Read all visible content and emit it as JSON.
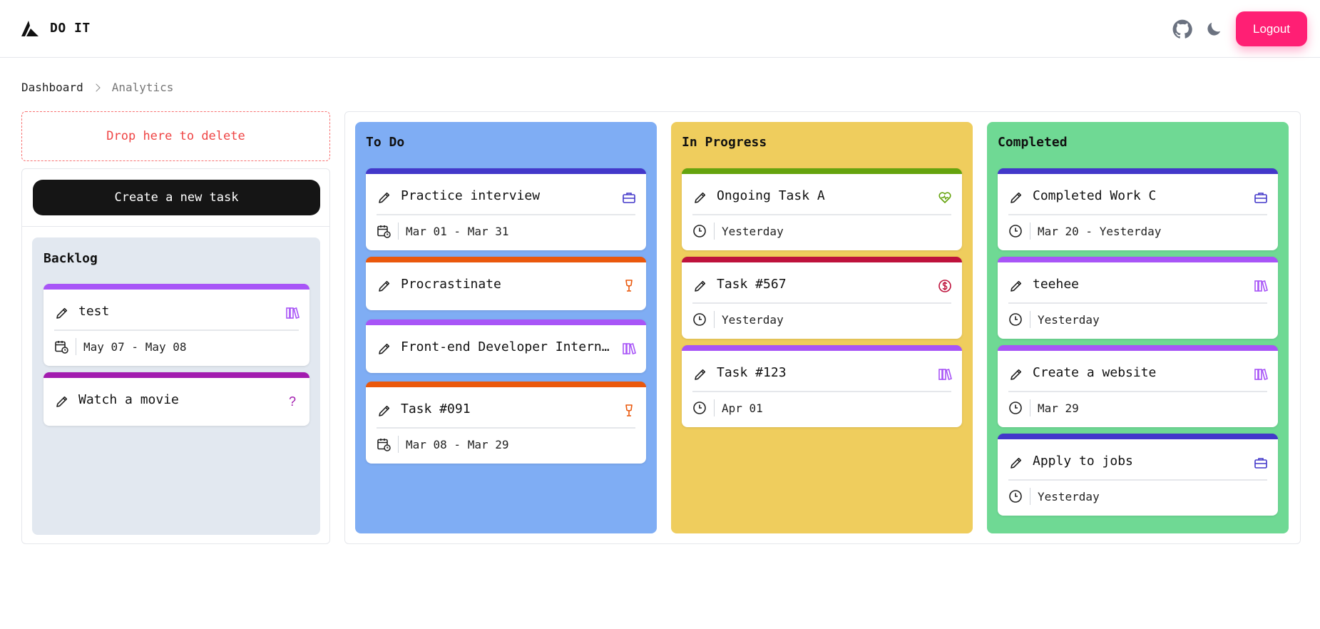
{
  "app": {
    "brand": "DO IT",
    "logout_label": "Logout"
  },
  "breadcrumb": {
    "home": "Dashboard",
    "current": "Analytics"
  },
  "drop_zone": {
    "label": "Drop here to delete"
  },
  "create_button": {
    "label": "Create a new task"
  },
  "colors": {
    "logout": "#ff1f74",
    "todo": "#7fadf4",
    "in_progress": "#efcd5d",
    "completed": "#6fd994",
    "backlog": "#e2e8f0",
    "stripe_indigo": "#4338ca",
    "stripe_orange": "#ea580c",
    "stripe_purple": "#a855f7",
    "stripe_magenta": "#a21caf",
    "stripe_green": "#65a30d",
    "stripe_red": "#be123c"
  },
  "backlog": {
    "title": "Backlog",
    "cards": [
      {
        "title": "test",
        "category_icon": "books-icon",
        "date_icon": "calendar-clock-icon",
        "date": "May 07 - May 08"
      },
      {
        "title": "Watch a movie",
        "category_icon": "question-icon",
        "category_glyph": "?"
      }
    ]
  },
  "columns": {
    "todo": {
      "title": "To Do",
      "cards": [
        {
          "title": "Practice interview",
          "category_icon": "briefcase-icon",
          "date_icon": "calendar-clock-icon",
          "date": "Mar 01 - Mar 31"
        },
        {
          "title": "Procrastinate",
          "category_icon": "drink-icon"
        },
        {
          "title": "Front-end Developer Internaa…",
          "category_icon": "books-icon"
        },
        {
          "title": "Task #091",
          "category_icon": "drink-icon",
          "date_icon": "calendar-clock-icon",
          "date": "Mar 08 - Mar 29"
        }
      ]
    },
    "in_progress": {
      "title": "In Progress",
      "cards": [
        {
          "title": "Ongoing Task A",
          "category_icon": "heart-pulse-icon",
          "date_icon": "clock-icon",
          "date": "Yesterday"
        },
        {
          "title": "Task #567",
          "category_icon": "dollar-icon",
          "date_icon": "clock-icon",
          "date": "Yesterday"
        },
        {
          "title": "Task #123",
          "category_icon": "books-icon",
          "date_icon": "clock-icon",
          "date": "Apr 01"
        }
      ]
    },
    "completed": {
      "title": "Completed",
      "cards": [
        {
          "title": "Completed Work C",
          "category_icon": "briefcase-icon",
          "date_icon": "clock-icon",
          "date": "Mar 20 - Yesterday"
        },
        {
          "title": "teehee",
          "category_icon": "books-icon",
          "date_icon": "clock-icon",
          "date": "Yesterday"
        },
        {
          "title": "Create a website",
          "category_icon": "books-icon",
          "date_icon": "clock-icon",
          "date": "Mar 29"
        },
        {
          "title": "Apply to jobs",
          "category_icon": "briefcase-icon",
          "date_icon": "clock-icon",
          "date": "Yesterday"
        }
      ]
    }
  }
}
